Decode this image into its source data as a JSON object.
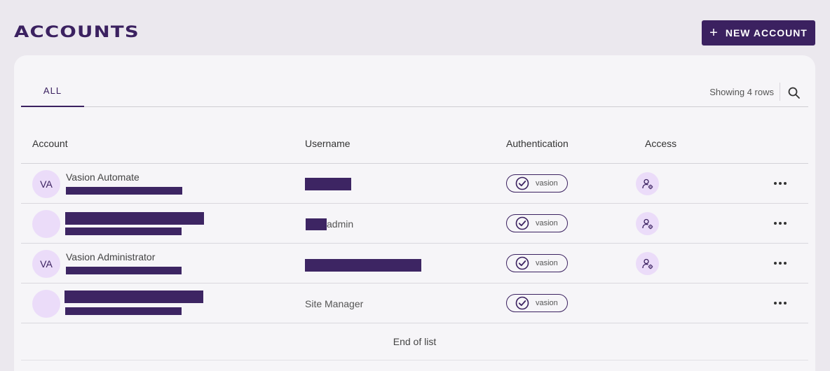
{
  "page": {
    "title": "ACCOUNTS"
  },
  "toolbar": {
    "new_account_label": "NEW ACCOUNT",
    "new_account_icon": "plus-icon"
  },
  "tabs": [
    {
      "label": "ALL",
      "active": true
    }
  ],
  "list_info": {
    "showing": "Showing 4 rows"
  },
  "table": {
    "headers": {
      "account": "Account",
      "username": "Username",
      "authentication": "Authentication",
      "access": "Access"
    },
    "rows": [
      {
        "initials": "VA",
        "name": "Vasion Automate",
        "username": "",
        "auth": "vasion",
        "has_access_icon": true
      },
      {
        "initials": "",
        "name": "",
        "username": "admin",
        "auth": "vasion",
        "has_access_icon": true
      },
      {
        "initials": "VA",
        "name": "Vasion Administrator",
        "username": "",
        "auth": "vasion",
        "has_access_icon": true
      },
      {
        "initials": "",
        "name": "",
        "username": "Site Manager",
        "auth": "vasion",
        "has_access_icon": false
      }
    ],
    "end_label": "End of list"
  },
  "colors": {
    "brand": "#3b2160",
    "avatar_bg": "#ebdcf9",
    "page_bg": "#ebe8ee",
    "card_bg": "#f6f5f8"
  }
}
